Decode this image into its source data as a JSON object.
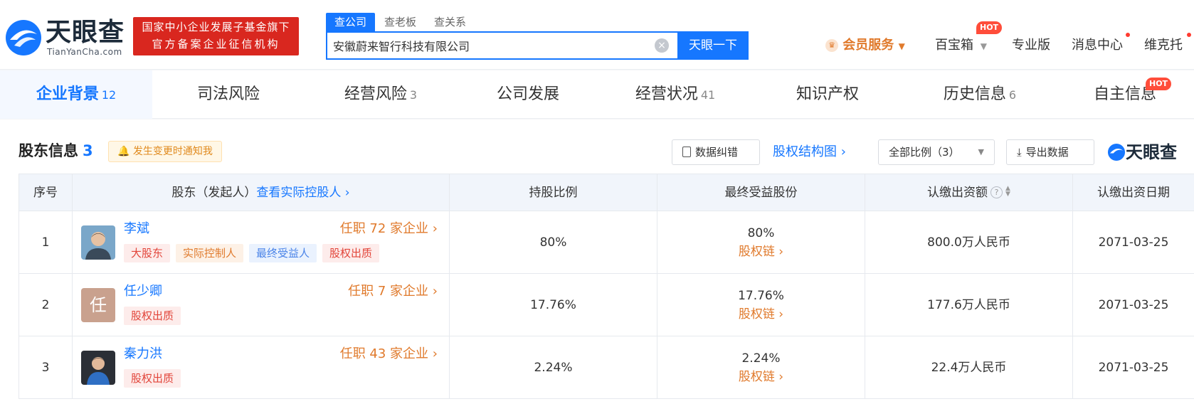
{
  "header": {
    "brand_name": "天眼查",
    "brand_domain": "TianYanCha.com",
    "badge_line1": "国家中小企业发展子基金旗下",
    "badge_line2": "官方备案企业征信机构",
    "search_tabs": [
      {
        "label": "查公司",
        "active": true
      },
      {
        "label": "查老板",
        "active": false
      },
      {
        "label": "查关系",
        "active": false
      }
    ],
    "search_value": "安徽蔚来智行科技有限公司",
    "search_button": "天眼一下",
    "nav": {
      "vip": "会员服务",
      "baibaoxiang": "百宝箱",
      "hot": "HOT",
      "pro": "专业版",
      "messages": "消息中心",
      "user": "维克托"
    }
  },
  "category_tabs": [
    {
      "label": "企业背景",
      "count": "12",
      "active": true
    },
    {
      "label": "司法风险",
      "count": "",
      "active": false
    },
    {
      "label": "经营风险",
      "count": "3",
      "active": false
    },
    {
      "label": "公司发展",
      "count": "",
      "active": false
    },
    {
      "label": "经营状况",
      "count": "41",
      "active": false
    },
    {
      "label": "知识产权",
      "count": "",
      "active": false
    },
    {
      "label": "历史信息",
      "count": "6",
      "active": false
    },
    {
      "label": "自主信息",
      "count": "",
      "active": false,
      "hot": "HOT"
    }
  ],
  "section": {
    "title": "股东信息",
    "count": "3",
    "notify": "发生变更时通知我",
    "correct_btn": "数据纠错",
    "structure_link": "股权结构图",
    "ratio_filter": "全部比例（3）",
    "export_btn": "导出数据",
    "watermark": "天眼查"
  },
  "table": {
    "headers": {
      "index": "序号",
      "shareholder": "股东（发起人）",
      "view_controller": "查看实际控股人",
      "ratio": "持股比例",
      "beneficial": "最终受益股份",
      "subscribed": "认缴出资额",
      "date": "认缴出资日期"
    },
    "equity_chain": "股权链",
    "rows": [
      {
        "index": "1",
        "name": "李斌",
        "avatar_char": "",
        "jobs": "任职 72 家企业",
        "tags": [
          "大股东",
          "实际控制人",
          "最终受益人",
          "股权出质"
        ],
        "ratio": "80%",
        "beneficial": "80%",
        "subscribed": "800.0万人民币",
        "date": "2071-03-25"
      },
      {
        "index": "2",
        "name": "任少卿",
        "avatar_char": "任",
        "jobs": "任职 7 家企业",
        "tags": [
          "股权出质"
        ],
        "ratio": "17.76%",
        "beneficial": "17.76%",
        "subscribed": "177.6万人民币",
        "date": "2071-03-25"
      },
      {
        "index": "3",
        "name": "秦力洪",
        "avatar_char": "",
        "jobs": "任职 43 家企业",
        "tags": [
          "股权出质"
        ],
        "ratio": "2.24%",
        "beneficial": "2.24%",
        "subscribed": "22.4万人民币",
        "date": "2071-03-25"
      }
    ]
  },
  "colors": {
    "primary": "#1677ff",
    "orange": "#e07a2c",
    "red": "#d9271f"
  }
}
